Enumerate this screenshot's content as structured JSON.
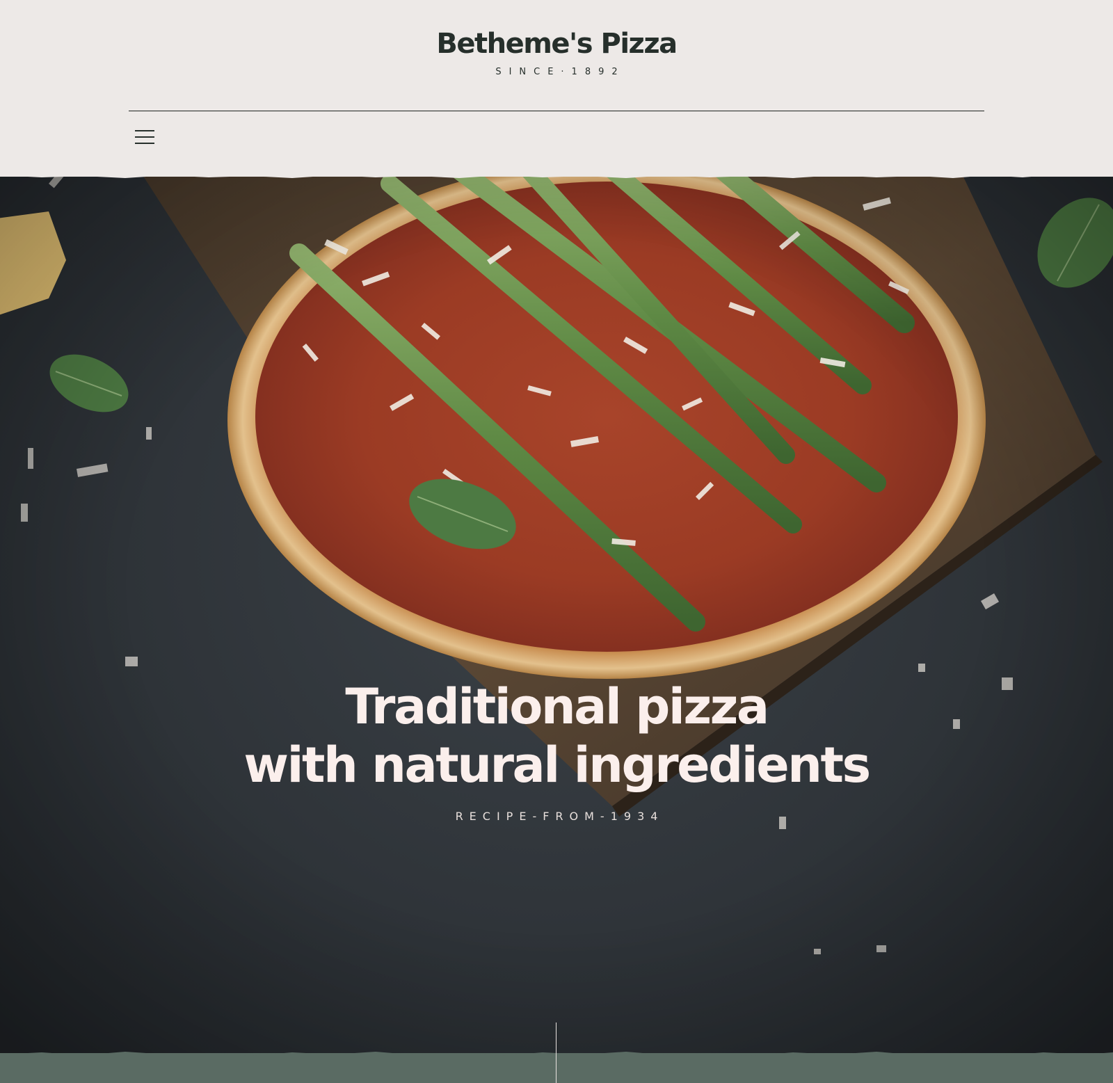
{
  "header": {
    "brand_name": "Betheme's Pizza",
    "brand_tagline": "SINCE·1892",
    "menu_icon": "hamburger-menu-icon"
  },
  "hero": {
    "title_line_1": "Traditional pizza",
    "title_line_2": "with natural ingredients",
    "subtitle": "RECIPE-FROM-1934"
  },
  "colors": {
    "header_bg": "#ede9e7",
    "brand_text": "#262f2b",
    "hero_bg": "#2e3338",
    "hero_title": "#fbefec",
    "bottom_band": "#5a6b63"
  }
}
